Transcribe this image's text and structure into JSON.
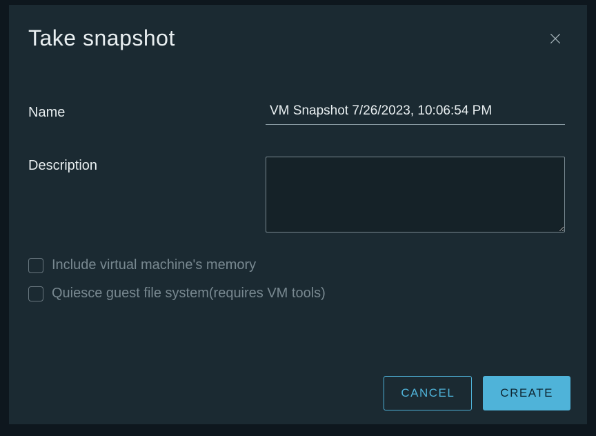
{
  "dialog": {
    "title": "Take snapshot"
  },
  "form": {
    "name_label": "Name",
    "name_value": "VM Snapshot 7/26/2023, 10:06:54 PM",
    "description_label": "Description",
    "description_value": "",
    "include_memory_label": "Include virtual machine's memory",
    "quiesce_label": "Quiesce guest file system(requires VM tools)"
  },
  "buttons": {
    "cancel": "CANCEL",
    "create": "CREATE"
  }
}
